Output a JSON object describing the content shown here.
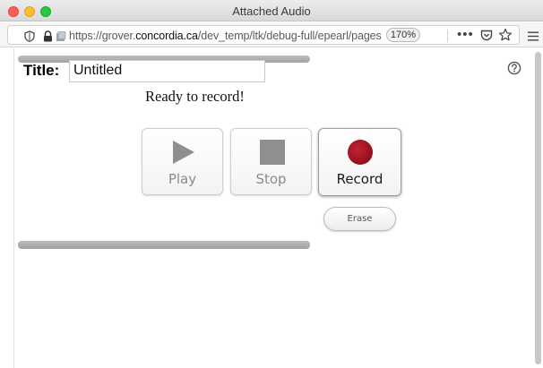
{
  "window": {
    "title": "Attached Audio"
  },
  "address_bar": {
    "url_prefix": "https://grover.",
    "url_domain": "concordia.ca",
    "url_path": "/dev_temp/ltk/debug-full/epearl/pages",
    "zoom": "170%"
  },
  "recorder": {
    "title_label": "Title:",
    "title_value": "Untitled",
    "status": "Ready to record!",
    "buttons": {
      "play": "Play",
      "stop": "Stop",
      "record": "Record",
      "erase": "Erase"
    }
  },
  "icons": {
    "help": "help-circle-icon",
    "play": "play-triangle-icon",
    "stop": "stop-square-icon",
    "record": "record-dot-icon"
  },
  "colors": {
    "record_dot": "#a01524",
    "control_icon_gray": "#8f8f8f",
    "panel_bar": "#a8a8a8"
  }
}
